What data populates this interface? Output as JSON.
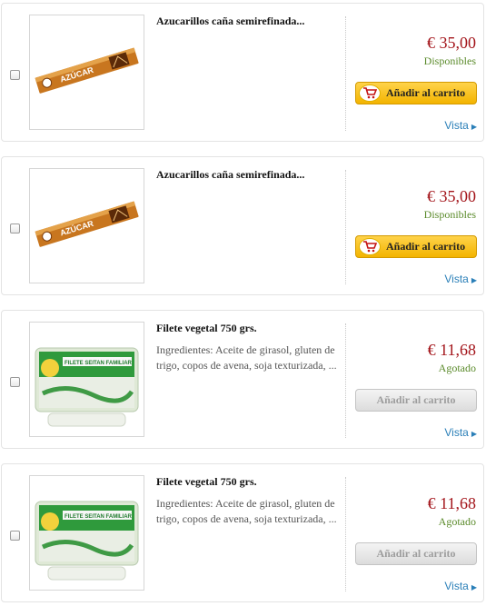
{
  "colors": {
    "price": "#a3141a",
    "available": "#5a8a2a",
    "button_active": "#f3b400",
    "button_disabled": "#dcdcdc",
    "link": "#2a7fb8"
  },
  "products": [
    {
      "title": "Azucarillos caña semirefinada...",
      "description": "",
      "price": "€ 35,00",
      "status": "Disponibles",
      "button_label": "Añadir al carrito",
      "button_enabled": true,
      "view_label": "Vista",
      "image": "sugar-stick-image",
      "image_text": "AZÚCAR"
    },
    {
      "title": "Azucarillos caña semirefinada...",
      "description": "",
      "price": "€ 35,00",
      "status": "Disponibles",
      "button_label": "Añadir al carrito",
      "button_enabled": true,
      "view_label": "Vista",
      "image": "sugar-stick-image",
      "image_text": "AZÚCAR"
    },
    {
      "title": "Filete vegetal 750 grs.",
      "description": "Ingredientes: Aceite de girasol, gluten de trigo, copos de avena, soja texturizada, ...",
      "price": "€ 11,68",
      "status": "Agotado",
      "button_label": "Añadir al carrito",
      "button_enabled": false,
      "view_label": "Vista",
      "image": "vegetable-fillet-package-image",
      "image_text": "FILETE SEITAN FAMILIAR"
    },
    {
      "title": "Filete vegetal 750 grs.",
      "description": "Ingredientes: Aceite de girasol, gluten de trigo, copos de avena, soja texturizada, ...",
      "price": "€ 11,68",
      "status": "Agotado",
      "button_label": "Añadir al carrito",
      "button_enabled": false,
      "view_label": "Vista",
      "image": "vegetable-fillet-package-image",
      "image_text": "FILETE SEITAN FAMILIAR"
    }
  ]
}
